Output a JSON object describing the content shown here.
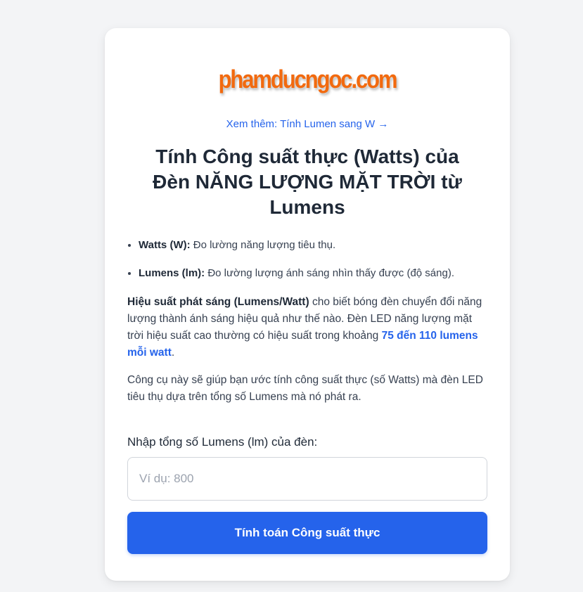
{
  "logo": {
    "text": "phamducngoc.com"
  },
  "see_more_link": "Xem thêm: Tính Lumen sang W →",
  "title": "Tính Công suất thực (Watts) của Đèn NĂNG LƯỢNG MẶT TRỜI từ Lumens",
  "definitions": [
    {
      "term": "Watts (W):",
      "desc": " Đo lường năng lượng tiêu thụ."
    },
    {
      "term": "Lumens (lm):",
      "desc": " Đo lường lượng ánh sáng nhìn thấy được (độ sáng)."
    }
  ],
  "efficiency_paragraph": {
    "bold": "Hiệu suất phát sáng (Lumens/Watt)",
    "text": " cho biết bóng đèn chuyển đổi năng lượng thành ánh sáng hiệu quả như thế nào. Đèn LED năng lượng mặt trời hiệu suất cao thường có hiệu suất trong khoảng ",
    "highlight": "75 đến 110 lumens mỗi watt",
    "end": "."
  },
  "tool_paragraph": "Công cụ này sẽ giúp bạn ước tính công suất thực (số Watts) mà đèn LED tiêu thụ dựa trên tổng số Lumens mà nó phát ra.",
  "form": {
    "label": "Nhập tổng số Lumens (lm) của đèn:",
    "placeholder": "Ví dụ: 800",
    "value": "",
    "button_label": "Tính toán Công suất thực"
  },
  "colors": {
    "logo": "#f26a0f",
    "accent": "#2563eb",
    "background": "#f3f4f6",
    "card": "#ffffff"
  }
}
